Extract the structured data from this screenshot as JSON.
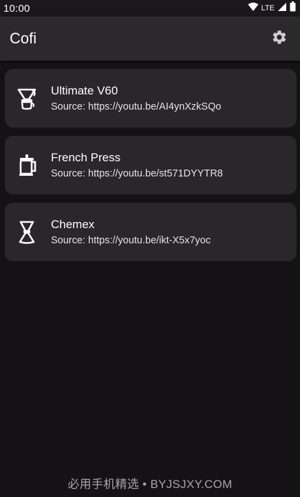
{
  "status_bar": {
    "time": "10:00",
    "network": "LTE",
    "icons": [
      "wifi-icon",
      "signal-icon",
      "battery-icon"
    ]
  },
  "app_bar": {
    "title": "Cofi",
    "settings_icon": "gear-icon"
  },
  "recipes": [
    {
      "name": "Ultimate V60",
      "source": "Source: https://youtu.be/AI4ynXzkSQo",
      "icon": "v60-dripper-icon"
    },
    {
      "name": "French Press",
      "source": "Source: https://youtu.be/st571DYYTR8",
      "icon": "french-press-icon"
    },
    {
      "name": "Chemex",
      "source": "Source: https://youtu.be/ikt-X5x7yoc",
      "icon": "chemex-icon"
    }
  ],
  "watermark": "必用手机精选 • BYJSJXY.COM",
  "colors": {
    "background": "#141214",
    "app_bar": "#2b292b",
    "card": "#29272a",
    "text": "#ffffff"
  }
}
